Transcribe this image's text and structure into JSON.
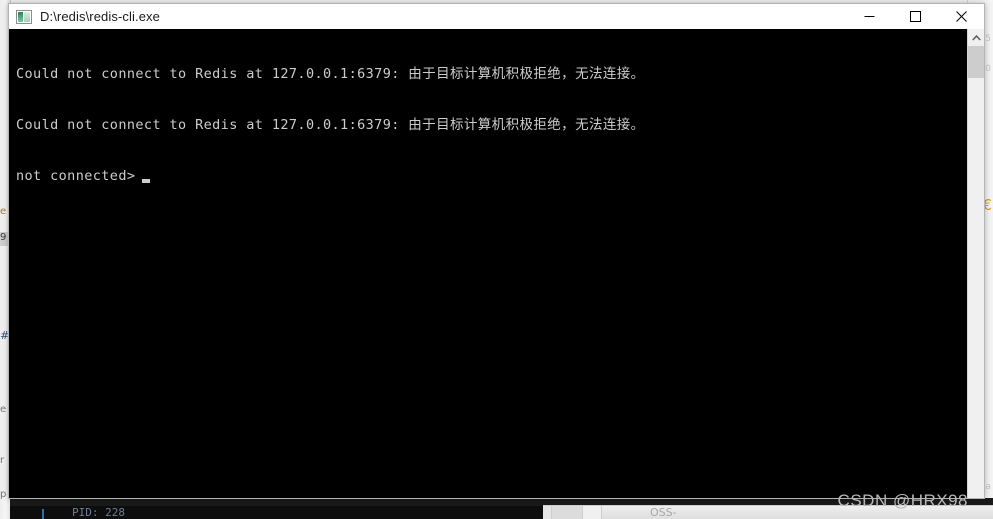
{
  "window": {
    "title": "D:\\redis\\redis-cli.exe",
    "icon": "console-app-icon",
    "controls": {
      "minimize": "minimize-icon",
      "maximize": "maximize-icon",
      "close": "close-icon"
    }
  },
  "console": {
    "lines": [
      "Could not connect to Redis at 127.0.0.1:6379: 由于目标计算机积极拒绝，无法连接。",
      "Could not connect to Redis at 127.0.0.1:6379: 由于目标计算机积极拒绝，无法连接。"
    ],
    "prompt": "not connected>",
    "foreground_color": "#cccccc",
    "background_color": "#000000"
  },
  "scrollbar": {
    "up_arrow": "chevron-up-icon"
  },
  "background": {
    "left_marks": [
      "e",
      "9",
      "#",
      "e",
      "r",
      "p"
    ],
    "right_marks": [
      "5",
      "0",
      "la"
    ],
    "right_symbol": "€",
    "status_pid": "PID: 228",
    "status_oss": "OSS-"
  },
  "watermark": {
    "text": "CSDN @HRX98"
  }
}
